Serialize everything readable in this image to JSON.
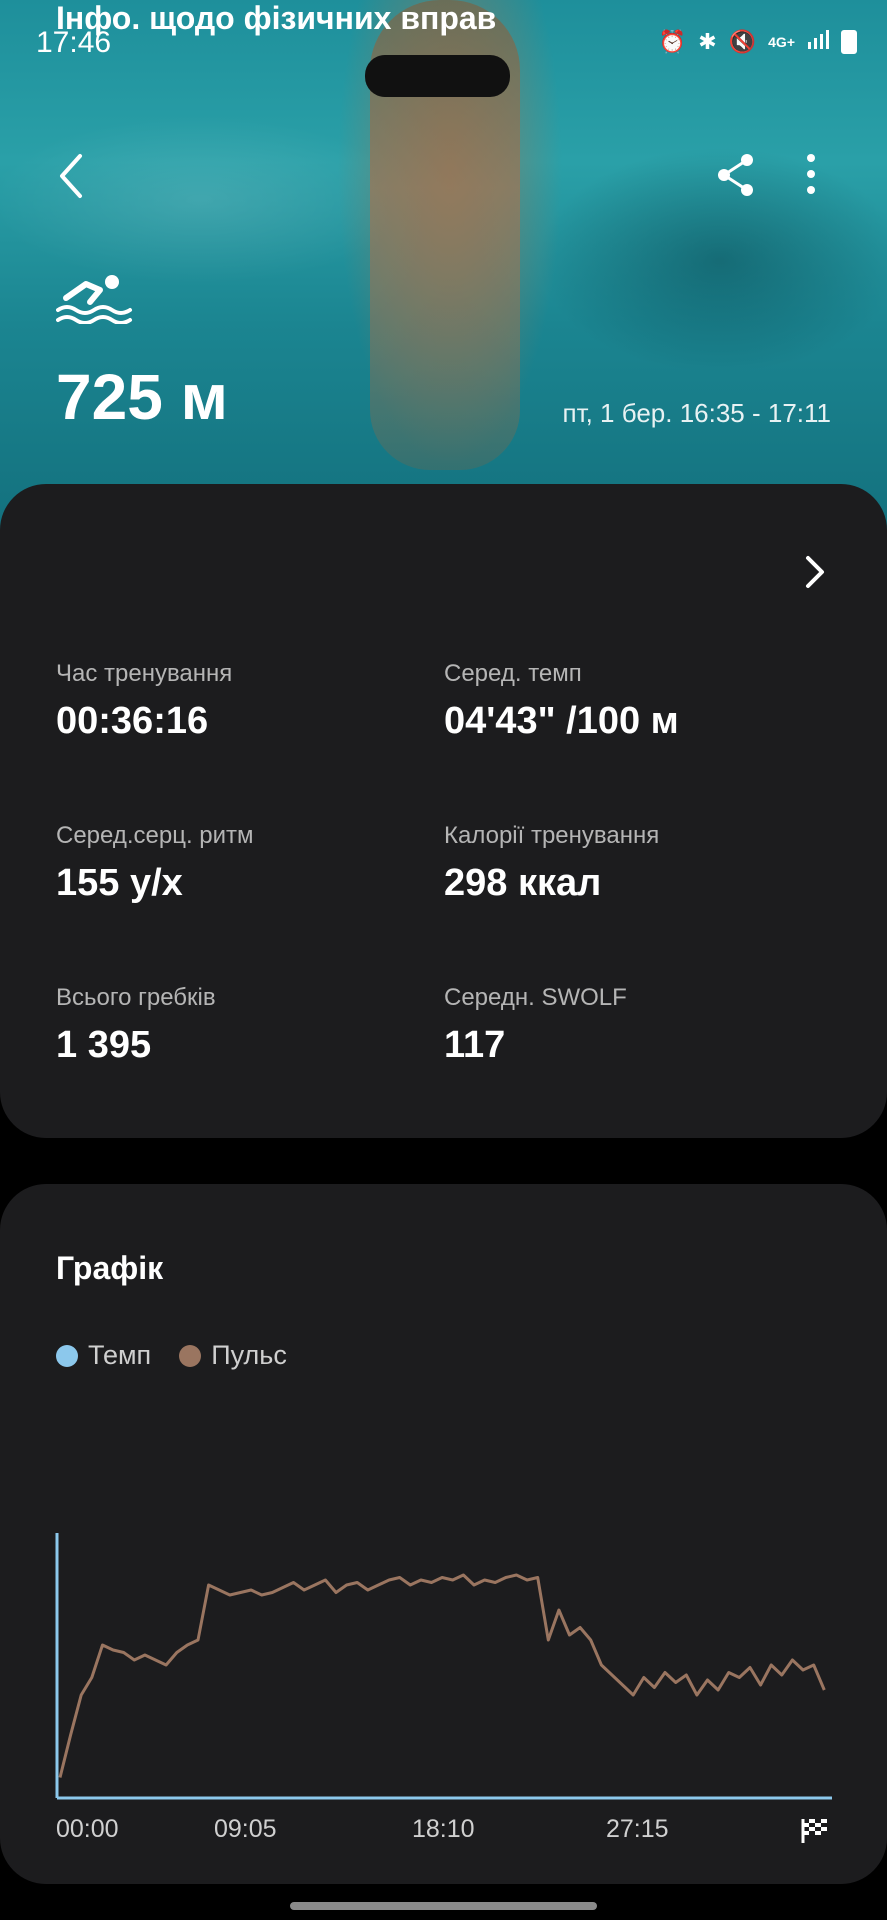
{
  "status_bar": {
    "time": "17:46",
    "icons": [
      "alarm-icon",
      "bluetooth-icon",
      "mute-icon",
      "4g-icon",
      "signal-icon",
      "battery-icon"
    ],
    "network": "4G+"
  },
  "header": {
    "distance": "725 м",
    "datetime": "пт, 1 бер. 16:35 - 17:11",
    "activity_icon": "swimming-icon"
  },
  "info_card": {
    "title": "Інфо. щодо фізичних вправ",
    "metrics": [
      {
        "label": "Час тренування",
        "value": "00:36:16"
      },
      {
        "label": "Серед. темп",
        "value": "04'43\" /100 м"
      },
      {
        "label": "Серед.серц. ритм",
        "value": "155 у/х"
      },
      {
        "label": "Калорії тренування",
        "value": "298 ккал"
      },
      {
        "label": "Всього гребків",
        "value": "1 395"
      },
      {
        "label": "Середн. SWOLF",
        "value": "117"
      }
    ]
  },
  "chart_card": {
    "title": "Графік",
    "legend": [
      {
        "label": "Темп",
        "color": "#8cc8ec"
      },
      {
        "label": "Пульс",
        "color": "#9a7560"
      }
    ]
  },
  "chart_data": {
    "type": "line",
    "x_tick_labels": [
      "00:00",
      "09:05",
      "18:10",
      "27:15"
    ],
    "x_unit": "minutes",
    "x_range": [
      0,
      36.27
    ],
    "series": [
      {
        "name": "Пульс",
        "color": "#9a7560",
        "x": [
          0,
          0.5,
          1,
          1.5,
          2,
          2.5,
          3,
          3.5,
          4,
          4.5,
          5,
          5.5,
          6,
          6.5,
          7,
          7.5,
          8,
          8.5,
          9,
          9.5,
          10,
          10.5,
          11,
          11.5,
          12,
          12.5,
          13,
          13.5,
          14,
          14.5,
          15,
          15.5,
          16,
          16.5,
          17,
          17.5,
          18,
          18.5,
          19,
          19.5,
          20,
          20.5,
          21,
          21.5,
          22,
          22.5,
          23,
          23.5,
          24,
          24.5,
          25,
          25.5,
          26,
          26.5,
          27,
          27.5,
          28,
          28.5,
          29,
          29.5,
          30,
          30.5,
          31,
          31.5,
          32,
          32.5,
          33,
          33.5,
          34,
          34.5,
          35,
          35.5,
          36
        ],
        "y": [
          0.05,
          0.22,
          0.38,
          0.45,
          0.58,
          0.56,
          0.55,
          0.52,
          0.54,
          0.52,
          0.5,
          0.55,
          0.58,
          0.6,
          0.82,
          0.8,
          0.78,
          0.79,
          0.8,
          0.78,
          0.79,
          0.81,
          0.83,
          0.8,
          0.82,
          0.84,
          0.79,
          0.82,
          0.83,
          0.8,
          0.82,
          0.84,
          0.85,
          0.82,
          0.84,
          0.83,
          0.85,
          0.84,
          0.86,
          0.82,
          0.84,
          0.83,
          0.85,
          0.86,
          0.84,
          0.85,
          0.6,
          0.72,
          0.62,
          0.65,
          0.6,
          0.5,
          0.46,
          0.42,
          0.38,
          0.45,
          0.41,
          0.47,
          0.43,
          0.46,
          0.38,
          0.44,
          0.4,
          0.47,
          0.45,
          0.49,
          0.42,
          0.5,
          0.46,
          0.52,
          0.48,
          0.5,
          0.4
        ]
      },
      {
        "name": "Темп",
        "color": "#8cc8ec",
        "note": "Axis lines only"
      }
    ],
    "grid": false
  }
}
